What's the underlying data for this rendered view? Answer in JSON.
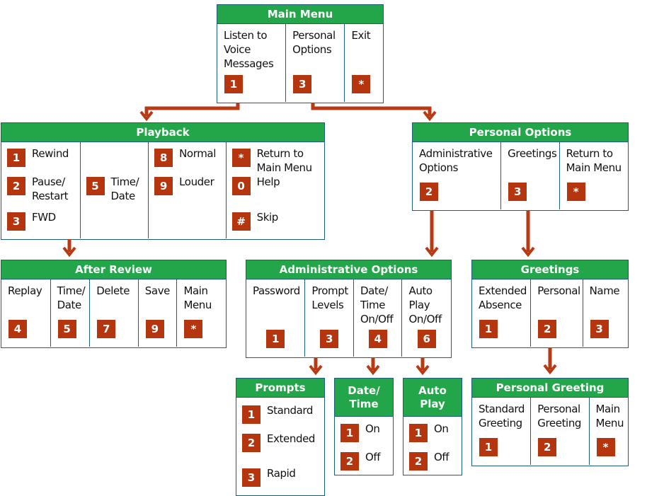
{
  "colors": {
    "header": "#23a64a",
    "badge": "#b5350f",
    "border": "#1f5f7a",
    "arrow": "#b83a14"
  },
  "boxes": [
    {
      "id": "main-menu",
      "title": "Main Menu",
      "type": "cols",
      "columns": [
        {
          "label": "Listen to\nVoice\nMessages",
          "key": "1"
        },
        {
          "label": "Personal\nOptions",
          "key": "3"
        },
        {
          "label": "Exit",
          "key": "*"
        }
      ]
    },
    {
      "id": "playback",
      "title": "Playback",
      "type": "list",
      "columns": [
        [
          {
            "key": "1",
            "label": "Rewind"
          },
          {
            "key": "2",
            "label": "Pause/\nRestart"
          },
          {
            "key": "3",
            "label": "FWD"
          }
        ],
        [
          {
            "key": "5",
            "label": "Time/\nDate"
          }
        ],
        [
          {
            "key": "8",
            "label": "Normal"
          },
          {
            "key": "9",
            "label": "Louder"
          }
        ],
        [
          {
            "key": "*",
            "label": "Return to\nMain Menu"
          },
          {
            "key": "0",
            "label": "Help"
          },
          {
            "key": "#",
            "label": "Skip"
          }
        ]
      ]
    },
    {
      "id": "personal-options",
      "title": "Personal Options",
      "type": "cols",
      "columns": [
        {
          "label": "Administrative\nOptions",
          "key": "2"
        },
        {
          "label": "Greetings",
          "key": "3"
        },
        {
          "label": "Return to\nMain Menu",
          "key": "*"
        }
      ]
    },
    {
      "id": "after-review",
      "title": "After Review",
      "type": "cols",
      "columns": [
        {
          "label": "Replay",
          "key": "4"
        },
        {
          "label": "Time/\nDate",
          "key": "5"
        },
        {
          "label": "Delete",
          "key": "7"
        },
        {
          "label": "Save",
          "key": "9"
        },
        {
          "label": "Main\nMenu",
          "key": "*"
        }
      ]
    },
    {
      "id": "administrative-options",
      "title": "Administrative Options",
      "type": "cols",
      "columns": [
        {
          "label": "Password",
          "key": "1"
        },
        {
          "label": "Prompt\nLevels",
          "key": "3"
        },
        {
          "label": "Date/\nTime\nOn/Off",
          "key": "4"
        },
        {
          "label": "Auto\nPlay\nOn/Off",
          "key": "6"
        }
      ]
    },
    {
      "id": "greetings",
      "title": "Greetings",
      "type": "cols",
      "columns": [
        {
          "label": "Extended\nAbsence",
          "key": "1"
        },
        {
          "label": "Personal",
          "key": "2"
        },
        {
          "label": "Name",
          "key": "3"
        }
      ]
    },
    {
      "id": "prompts",
      "title": "Prompts",
      "type": "list",
      "columns": [
        [
          {
            "key": "1",
            "label": "Standard"
          },
          {
            "key": "2",
            "label": "Extended"
          },
          {
            "key": "3",
            "label": "Rapid"
          }
        ]
      ]
    },
    {
      "id": "date-time",
      "title": "Date/\nTime",
      "type": "list",
      "columns": [
        [
          {
            "key": "1",
            "label": "On"
          },
          {
            "key": "2",
            "label": "Off"
          }
        ]
      ]
    },
    {
      "id": "auto-play",
      "title": "Auto\nPlay",
      "type": "list",
      "columns": [
        [
          {
            "key": "1",
            "label": "On"
          },
          {
            "key": "2",
            "label": "Off"
          }
        ]
      ]
    },
    {
      "id": "personal-greeting",
      "title": "Personal Greeting",
      "type": "cols",
      "columns": [
        {
          "label": "Standard\nGreeting",
          "key": "1"
        },
        {
          "label": "Personal\nGreeting",
          "key": "2"
        },
        {
          "label": "Main\nMenu",
          "key": "*"
        }
      ]
    }
  ]
}
